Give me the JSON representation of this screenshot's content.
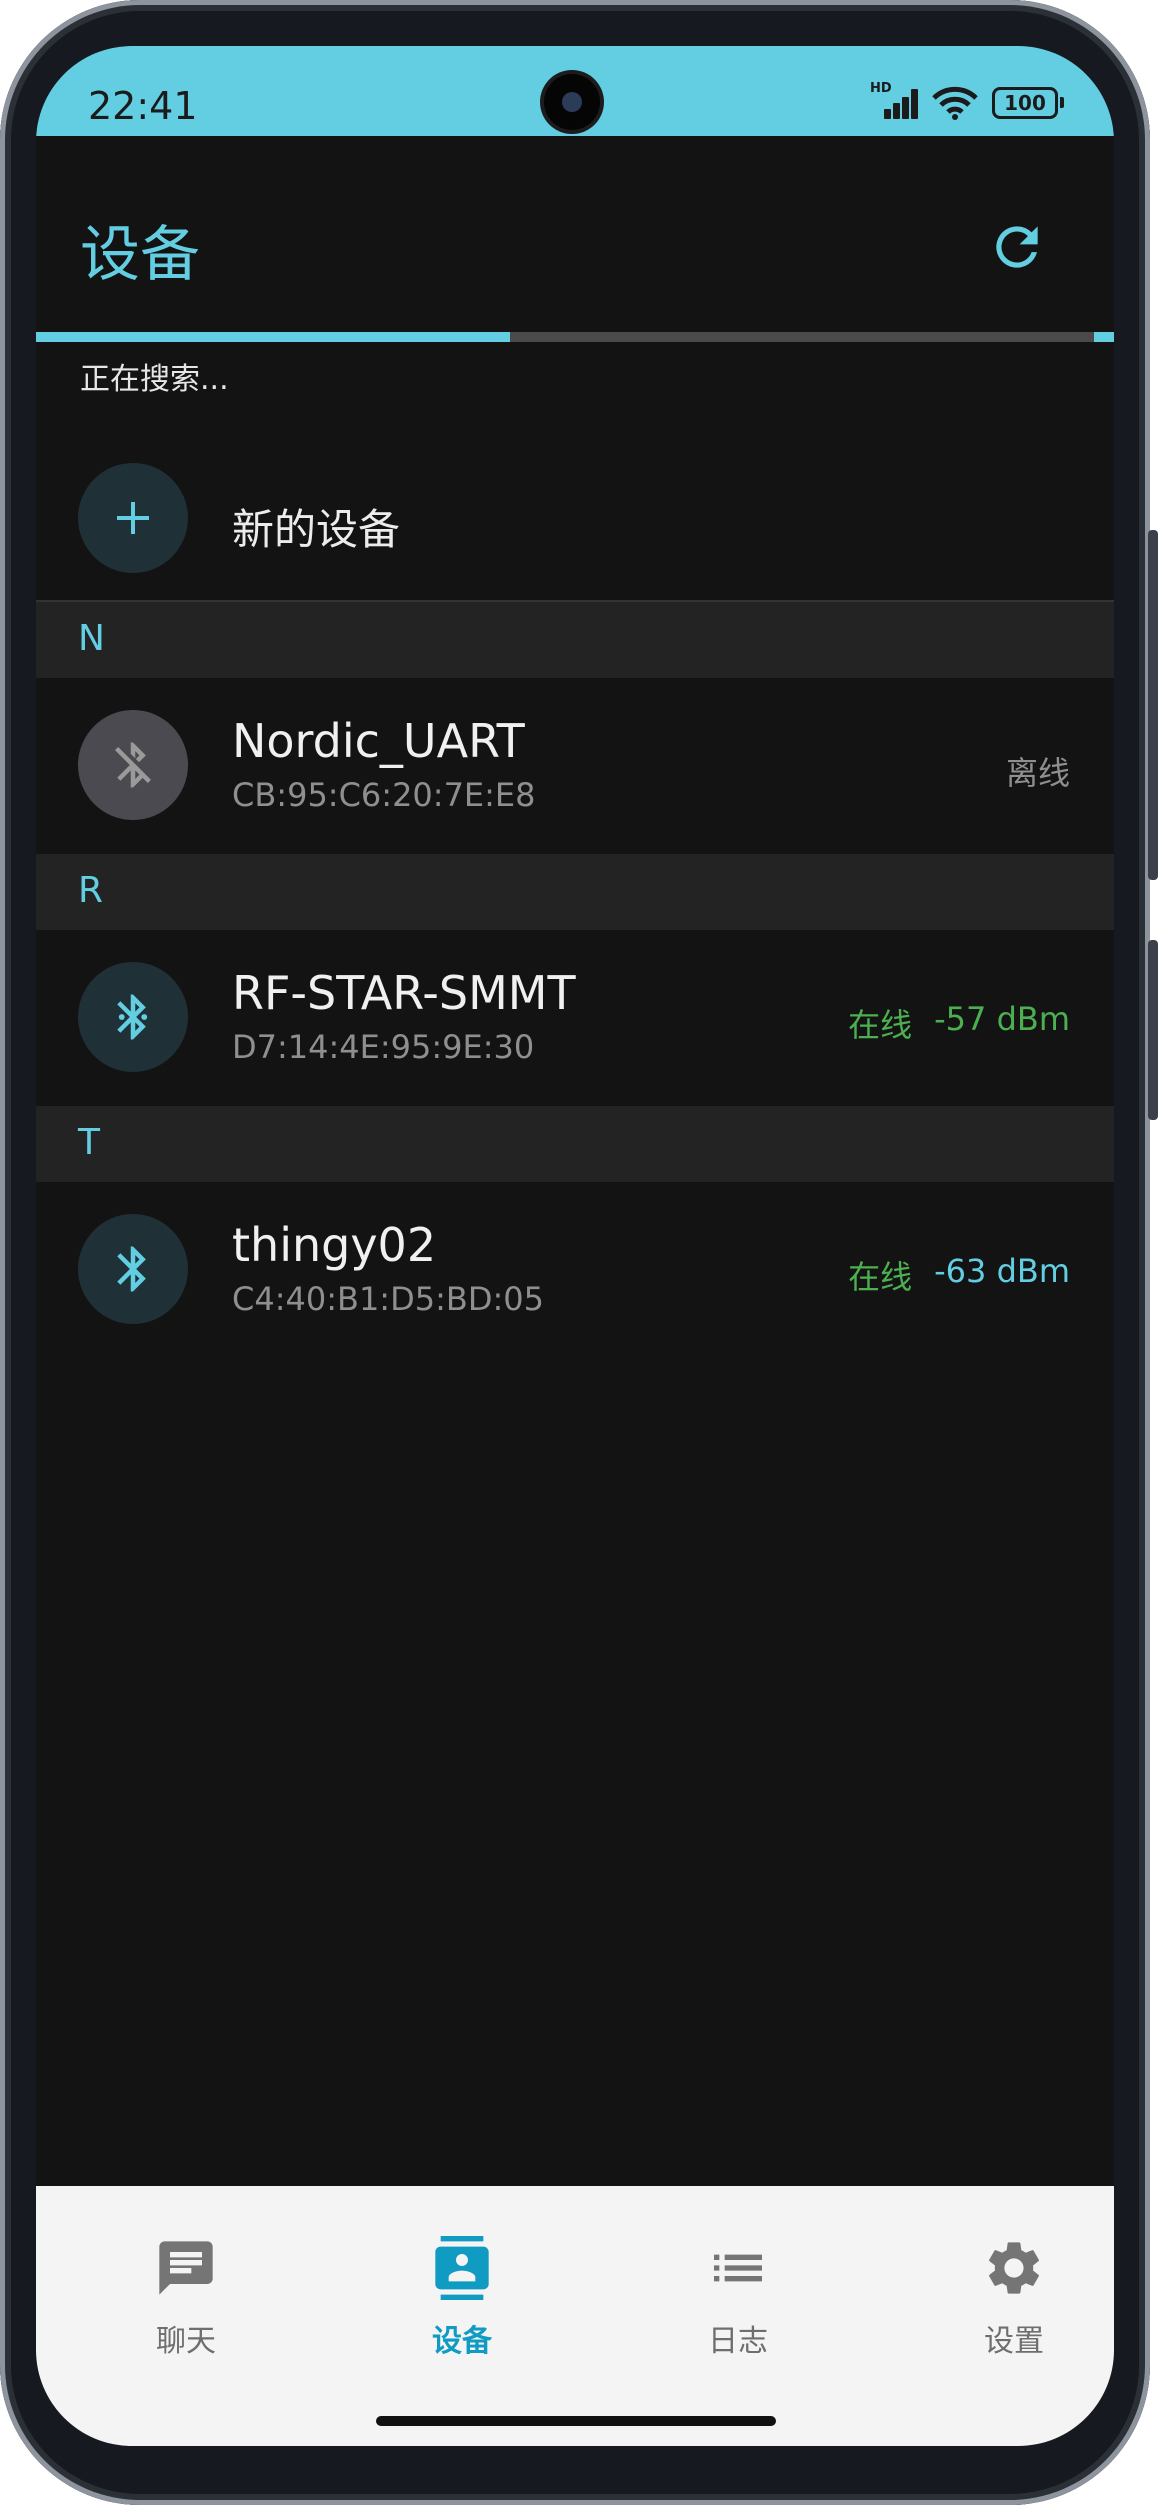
{
  "status_bar": {
    "time": "22:41",
    "network": "HD",
    "battery": "100"
  },
  "app_bar": {
    "title": "设备",
    "refresh_icon": "refresh-icon"
  },
  "scan": {
    "status_text": "正在搜索...",
    "progress": 0.44
  },
  "new_device": {
    "label": "新的设备",
    "icon": "plus-icon"
  },
  "sections": [
    {
      "letter": "N",
      "device": {
        "name": "Nordic_UART",
        "mac": "CB:95:C6:20:7E:E8",
        "state": "离线",
        "rssi": "",
        "online": false
      }
    },
    {
      "letter": "R",
      "device": {
        "name": "RF-STAR-SMMT",
        "mac": "D7:14:4E:95:9E:30",
        "state": "在线",
        "rssi": "-57 dBm",
        "online": true
      }
    },
    {
      "letter": "T",
      "device": {
        "name": "thingy02",
        "mac": "C4:40:B1:D5:BD:05",
        "state": "在线",
        "rssi": "-63 dBm",
        "online": true
      }
    }
  ],
  "bottom_nav": [
    {
      "label": "聊天",
      "icon": "chat-icon",
      "active": false
    },
    {
      "label": "设备",
      "icon": "device-contact-icon",
      "active": true
    },
    {
      "label": "日志",
      "icon": "list-icon",
      "active": false
    },
    {
      "label": "设置",
      "icon": "gear-icon",
      "active": false
    }
  ],
  "colors": {
    "accent": "#63cee2",
    "online": "#4caf50",
    "rssi_good": "#4caf50",
    "rssi_fair": "#63cee2",
    "nav_active": "#0f9bc2"
  }
}
